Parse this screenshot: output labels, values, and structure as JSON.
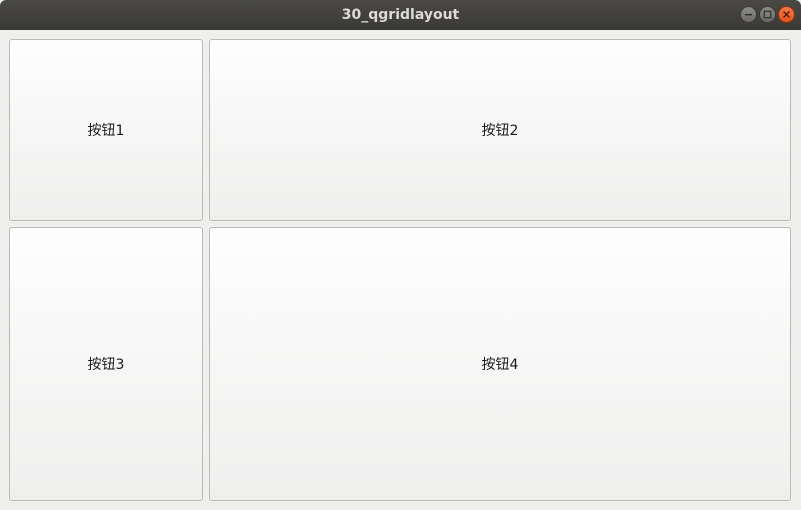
{
  "window": {
    "title": "30_qgridlayout",
    "controls": {
      "minimize_icon": "minimize-icon",
      "maximize_icon": "maximize-icon",
      "close_icon": "close-icon",
      "close_color": "#e9541d"
    }
  },
  "grid": {
    "buttons": [
      {
        "label": "按钮1"
      },
      {
        "label": "按钮2"
      },
      {
        "label": "按钮3"
      },
      {
        "label": "按钮4"
      }
    ]
  }
}
